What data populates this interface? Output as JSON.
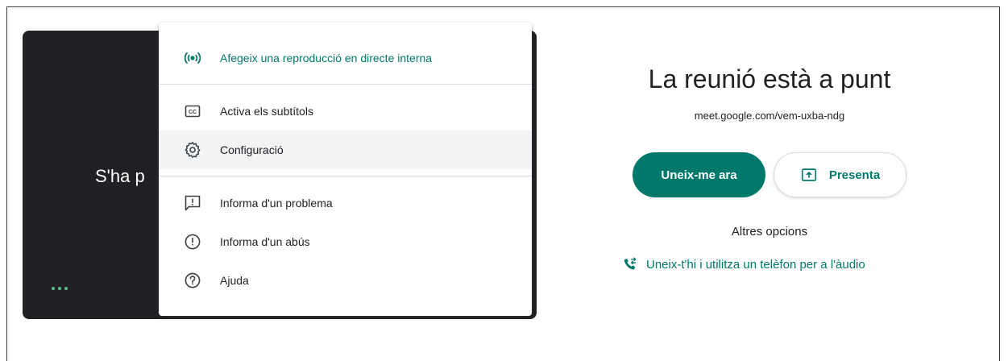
{
  "preview": {
    "status_text": "S'ha p",
    "more_options_icon": "more-horiz-icon"
  },
  "menu": {
    "items": [
      {
        "label": "Afegeix una reproducció en directe interna",
        "icon": "live-stream-icon"
      },
      {
        "label": "Activa els subtítols",
        "icon": "closed-captions-icon"
      },
      {
        "label": "Configuració",
        "icon": "settings-icon"
      },
      {
        "label": "Informa d'un problema",
        "icon": "feedback-icon"
      },
      {
        "label": "Informa d'un abús",
        "icon": "report-abuse-icon"
      },
      {
        "label": "Ajuda",
        "icon": "help-icon"
      }
    ]
  },
  "join_panel": {
    "title": "La reunió està a punt",
    "meeting_url": "meet.google.com/vem-uxba-ndg",
    "join_label": "Uneix-me ara",
    "present_label": "Presenta",
    "other_options": "Altres opcions",
    "phone_label": "Uneix-t'hi i utilitza un telèfon per a l'àudio"
  },
  "colors": {
    "accent": "#00796b",
    "preview_bg": "#202124",
    "hover_bg": "#f1f3f4"
  }
}
